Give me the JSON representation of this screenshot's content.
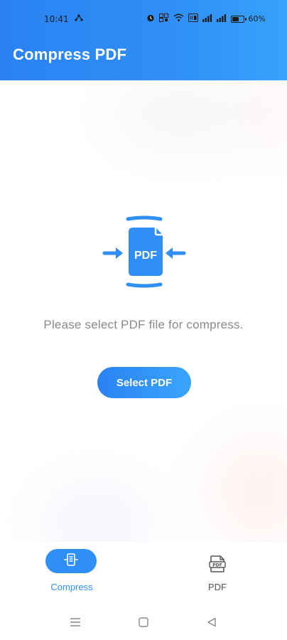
{
  "status_bar": {
    "time": "10:41",
    "battery_text": "60%",
    "battery_level": 0.6,
    "icons": [
      "usb-icon",
      "alarm-icon",
      "nfc-icon",
      "wifi-icon",
      "vowifi-icon",
      "signal-icon",
      "signal-icon",
      "battery-icon"
    ]
  },
  "header": {
    "title": "Compress PDF"
  },
  "main": {
    "illustration_label": "PDF",
    "prompt": "Please select PDF file for compress.",
    "select_button": "Select PDF"
  },
  "bottom_nav": {
    "items": [
      {
        "label": "Compress",
        "icon": "compress-icon",
        "active": true
      },
      {
        "label": "PDF",
        "icon": "pdf-file-icon",
        "active": false
      }
    ],
    "pdf_icon_text": "PDF"
  },
  "system_nav": {
    "icons": [
      "menu-icon",
      "home-icon",
      "back-icon"
    ]
  },
  "colors": {
    "accent": "#2f8ff6",
    "header_gradient_start": "#2a82f2",
    "header_gradient_end": "#37a2fb",
    "prompt_text": "#8a8a8a"
  }
}
